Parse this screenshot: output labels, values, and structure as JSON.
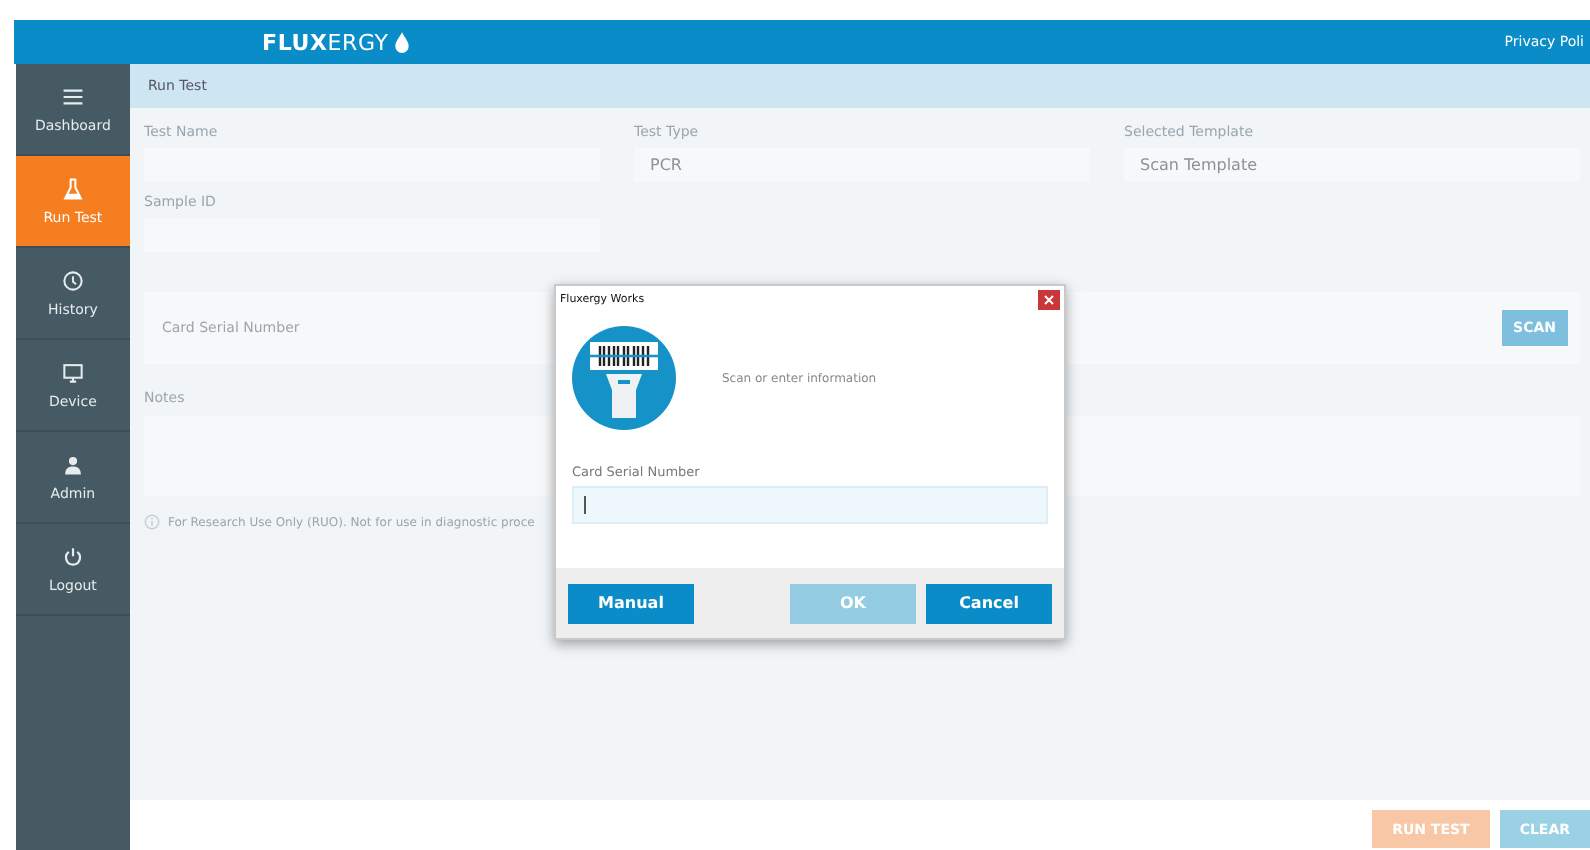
{
  "header": {
    "logo": "**FLUX**ERGY",
    "link": "Privacy Poli"
  },
  "sidebar": {
    "items": [
      {
        "label": "Dashboard",
        "kind": "menu",
        "selected": false
      },
      {
        "label": "Run Test",
        "kind": "flask",
        "selected": true
      },
      {
        "label": "History",
        "kind": "history",
        "selected": false
      },
      {
        "label": "Device",
        "kind": "monitor",
        "selected": false
      },
      {
        "label": "Admin",
        "kind": "user",
        "selected": false
      },
      {
        "label": "Logout",
        "kind": "power",
        "selected": false
      }
    ]
  },
  "breadcrumb": "Run Test",
  "form": {
    "fields": [
      {
        "label": "Test Name"
      },
      {
        "label": "Test Type",
        "value": "PCR"
      },
      {
        "label": "Selected Template",
        "value": "Scan Template"
      },
      {
        "label": "Sample ID"
      }
    ]
  },
  "card_panel": {
    "label": "Card Serial Number",
    "button": "SCAN"
  },
  "notes": {
    "label": "Notes"
  },
  "notice": "For Research Use Only (RUO). Not for use in diagnostic proce",
  "footer": {
    "buttons": [
      {
        "label": "RUN TEST",
        "kind": "primary"
      },
      {
        "label": "CLEAR",
        "kind": "secondary"
      }
    ]
  },
  "dialog": {
    "title": "Fluxergy Works",
    "message": "Scan or enter information",
    "field_label": "Card Serial Number",
    "buttons": [
      {
        "label": "Manual",
        "disabled": false
      },
      {
        "label": "OK",
        "disabled": true
      },
      {
        "label": "Cancel",
        "disabled": false
      }
    ]
  }
}
